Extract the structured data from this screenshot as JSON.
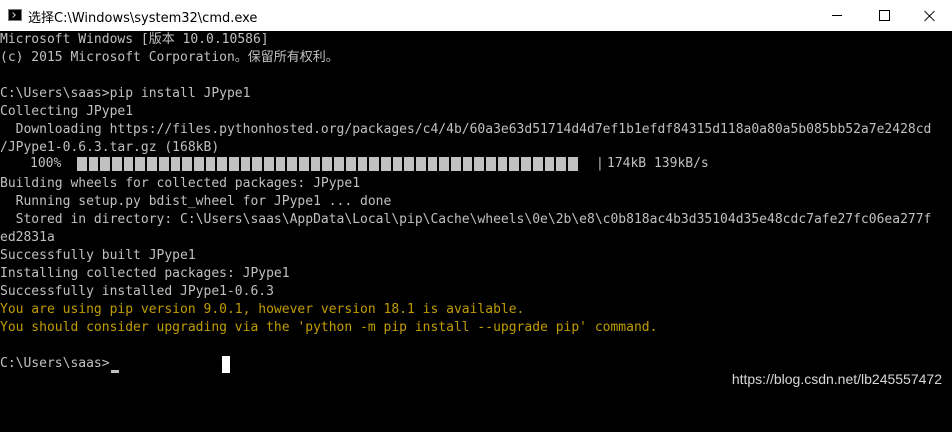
{
  "window": {
    "title": "选择C:\\Windows\\system32\\cmd.exe",
    "icon": "cmd-icon",
    "controls": [
      "minimize-icon",
      "maximize-icon",
      "close-icon"
    ]
  },
  "console": {
    "lines": [
      "Microsoft Windows [版本 10.0.10586]",
      "(c) 2015 Microsoft Corporation。保留所有权利。",
      "",
      "C:\\Users\\saas>pip install JPype1",
      "Collecting JPype1",
      "  Downloading https://files.pythonhosted.org/packages/c4/4b/60a3e63d51714d4d7ef1b1efdf84315d118a0a80a5b085bb52a7e2428cd",
      "/JPype1-0.6.3.tar.gz (168kB)",
      "",
      "Building wheels for collected packages: JPype1",
      "  Running setup.py bdist_wheel for JPype1 ... done",
      "  Stored in directory: C:\\Users\\saas\\AppData\\Local\\pip\\Cache\\wheels\\0e\\2b\\e8\\c0b818ac4b3d35104d35e48cdc7afe27fc06ea277f",
      "ed2831a",
      "Successfully built JPype1",
      "Installing collected packages: JPype1",
      "Successfully installed JPype1-0.6.3",
      "You are using pip version 9.0.1, however version 18.1 is available.",
      "You should consider upgrading via the 'python -m pip install --upgrade pip' command.",
      "",
      "C:\\Users\\saas>"
    ],
    "progress": {
      "percent_text": "100%",
      "fraction": 1.0,
      "separator": "|",
      "rate_text": "174kB 139kB/s"
    },
    "colors": {
      "background": "#000000",
      "text": "#c0c0c0",
      "warning": "#c19c00"
    }
  },
  "watermark": "https://blog.csdn.net/lb245557472"
}
